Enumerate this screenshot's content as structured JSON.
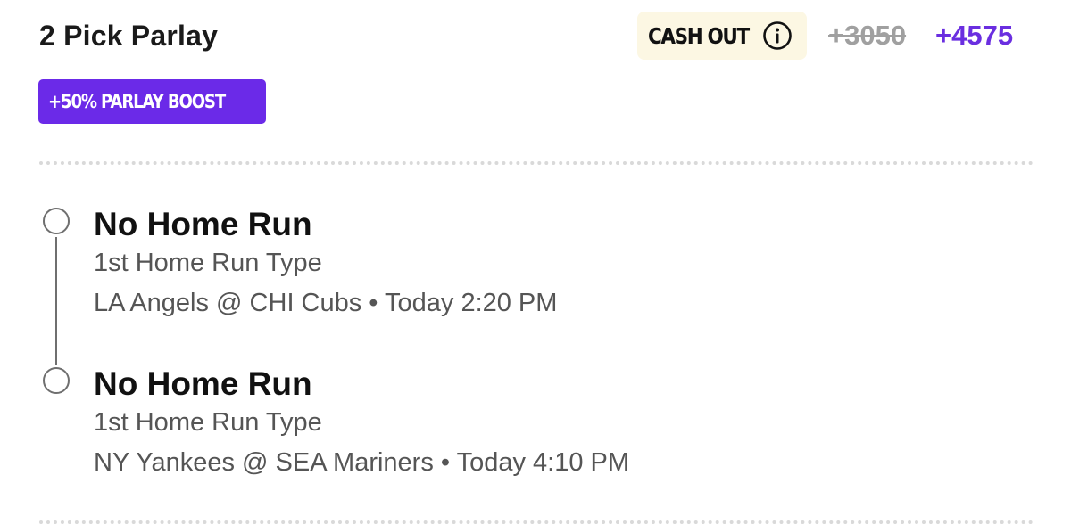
{
  "bet": {
    "title": "2 Pick Parlay",
    "cash_out_label": "CASH OUT",
    "odds_original": "+3050",
    "odds_boosted": "+4575",
    "boost_label": "+50% PARLAY BOOST",
    "info_icon": "info-circle-icon"
  },
  "legs": [
    {
      "selection": "No Home Run",
      "market": "1st Home Run Type",
      "game": "LA Angels @ CHI Cubs • Today 2:20 PM"
    },
    {
      "selection": "No Home Run",
      "market": "1st Home Run Type",
      "game": "NY Yankees @ SEA Mariners • Today 4:10 PM"
    }
  ],
  "colors": {
    "accent": "#6a2ee0",
    "cash_out_bg": "#fcf7e3",
    "struck_odds": "#a0a0a0",
    "text_secondary": "#555555"
  }
}
